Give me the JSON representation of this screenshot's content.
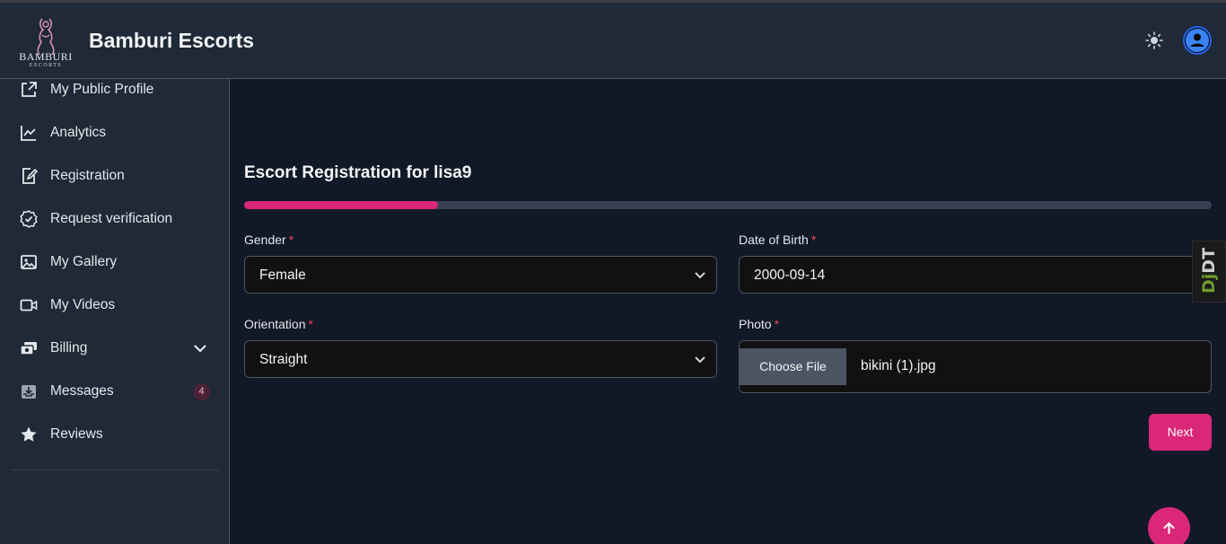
{
  "header": {
    "logo": {
      "name": "BAMBURI",
      "sub": "ESCORTS"
    },
    "title": "Bamburi Escorts"
  },
  "sidebar": {
    "items": [
      {
        "label": "My Public Profile",
        "icon": "external-link-icon"
      },
      {
        "label": "Analytics",
        "icon": "line-chart-icon"
      },
      {
        "label": "Registration",
        "icon": "edit-document-icon"
      },
      {
        "label": "Request verification",
        "icon": "verified-badge-icon"
      },
      {
        "label": "My Gallery",
        "icon": "image-icon"
      },
      {
        "label": "My Videos",
        "icon": "video-icon"
      },
      {
        "label": "Billing",
        "icon": "money-icon"
      },
      {
        "label": "Messages",
        "icon": "inbox-icon",
        "badge": "4"
      },
      {
        "label": "Reviews",
        "icon": "star-icon"
      }
    ]
  },
  "main": {
    "title": "Escort Registration for lisa9",
    "progress": 0.2,
    "fields": {
      "gender": {
        "label": "Gender",
        "required": "*",
        "value": "Female"
      },
      "dob": {
        "label": "Date of Birth",
        "required": "*",
        "value": "2000-09-14"
      },
      "orientation": {
        "label": "Orientation",
        "required": "*",
        "value": "Straight"
      },
      "photo": {
        "label": "Photo",
        "required": "*",
        "button": "Choose File",
        "filename": "bikini (1).jpg"
      }
    },
    "next_label": "Next"
  },
  "debug_toolbar": {
    "prefix": "Dj",
    "suffix": "DT"
  },
  "colors": {
    "accent": "#db2777",
    "background": "#111827",
    "panel": "#1f2937"
  }
}
